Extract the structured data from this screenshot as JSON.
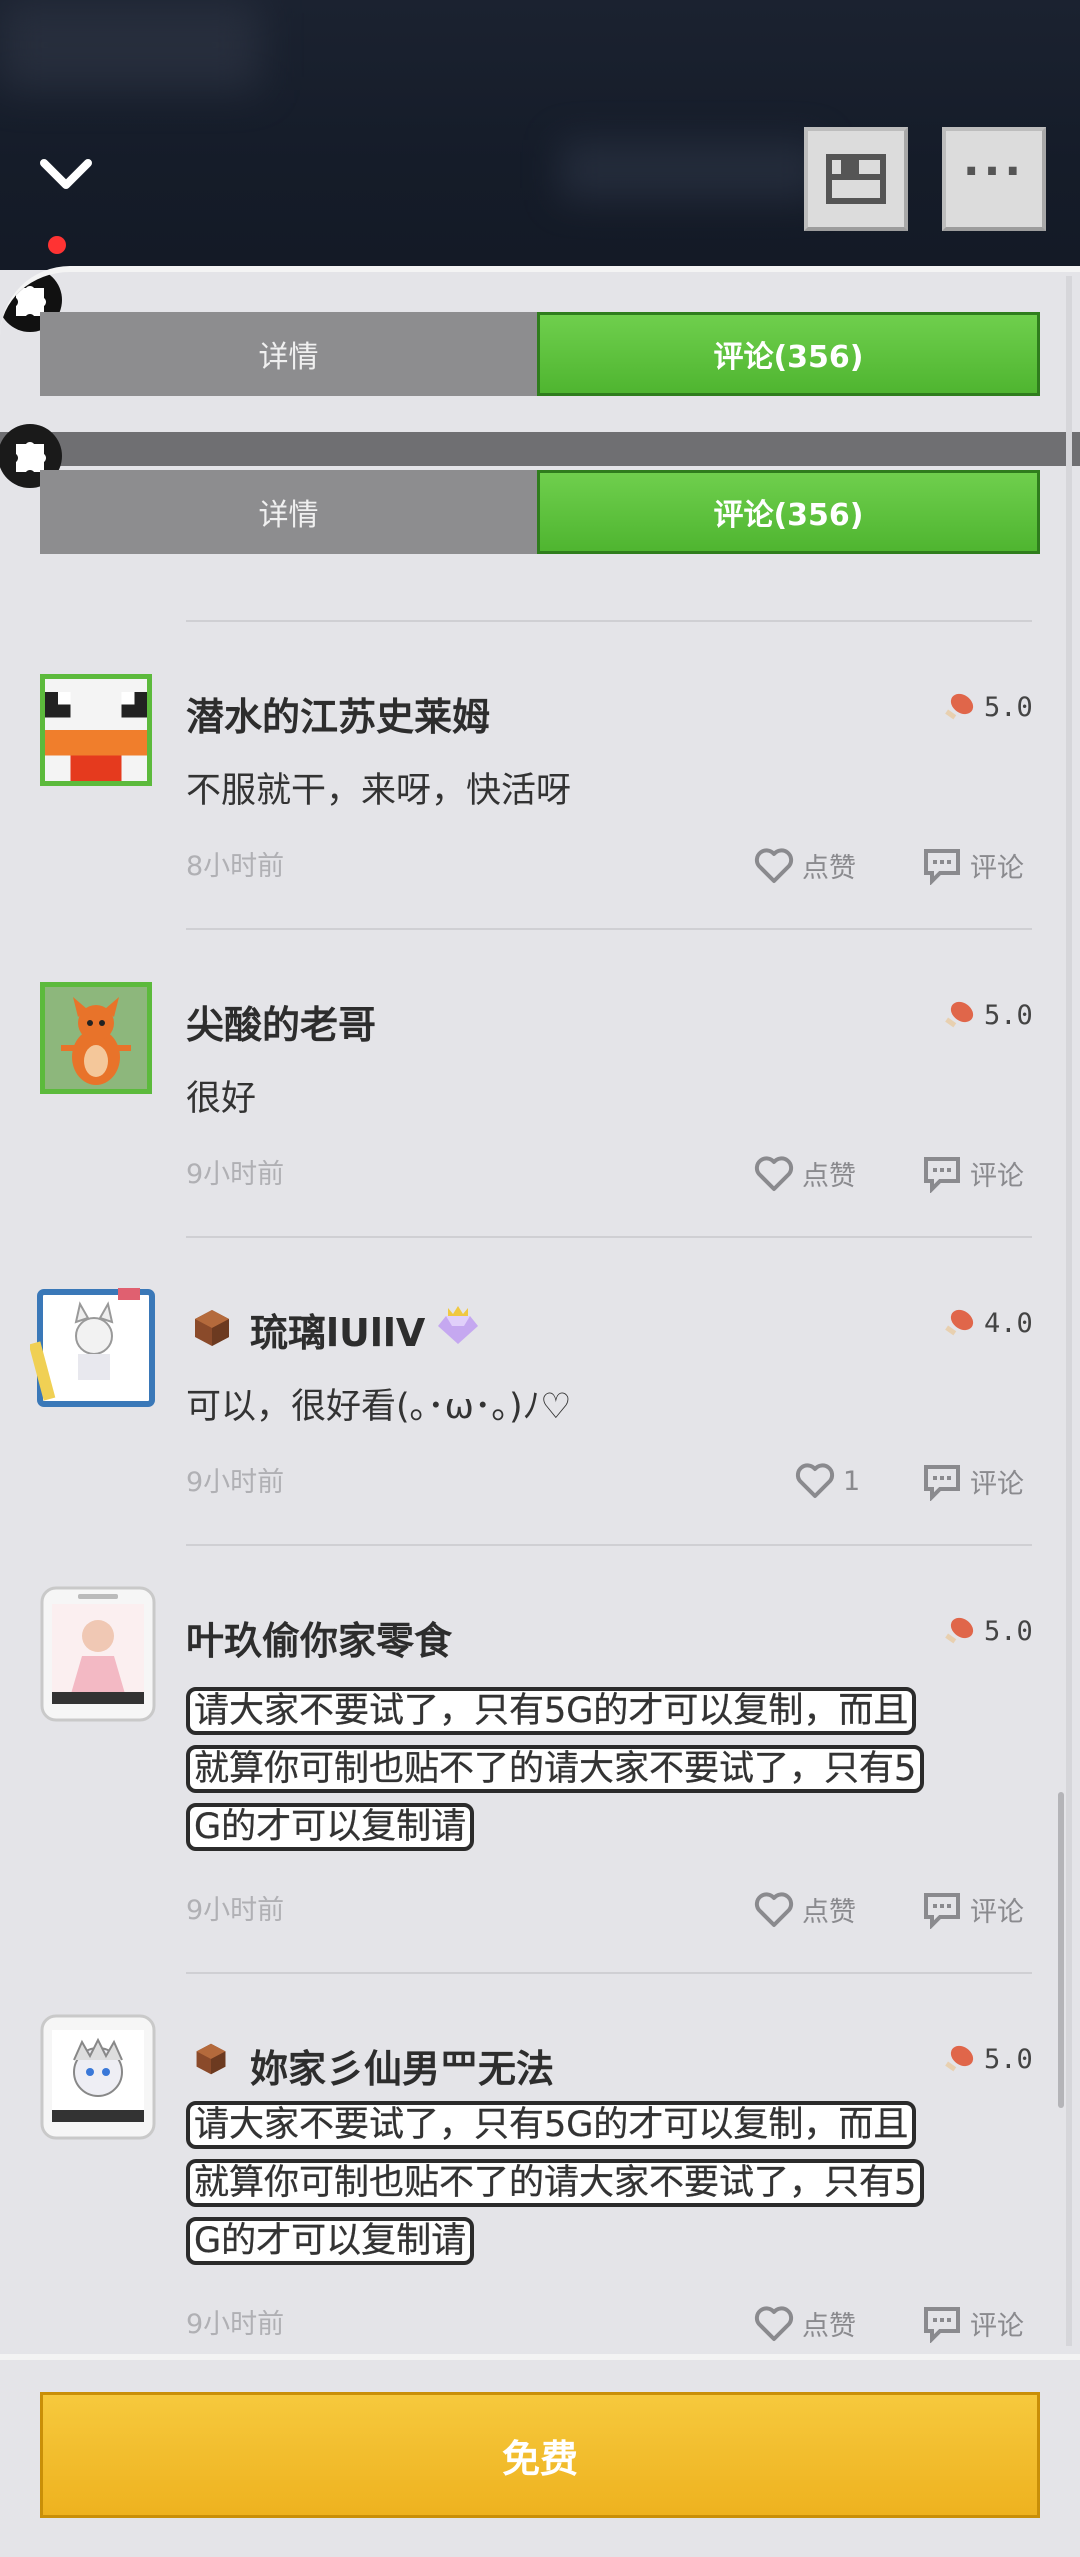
{
  "header": {
    "collapse_icon": "chevron-down-icon",
    "folder_icon": "folder-icon",
    "more_icon": "more-icon"
  },
  "tabs": {
    "details": "详情",
    "comments": "评论(356)"
  },
  "comments": [
    {
      "name": "潜水的江苏史莱姆",
      "rating": "5.0",
      "text": "不服就干，来呀，快活呀",
      "time": "8小时前",
      "like": "点赞",
      "reply": "评论"
    },
    {
      "name": "尖酸的老哥",
      "rating": "5.0",
      "text": "很好",
      "time": "9小时前",
      "like": "点赞",
      "reply": "评论"
    },
    {
      "name": "琉璃lUllV",
      "rating": "4.0",
      "text": "可以，很好看(｡･ω･｡)ﾉ♡",
      "time": "9小时前",
      "like": "1",
      "reply": "评论"
    },
    {
      "name": "叶玖偷你家零食",
      "rating": "5.0",
      "text_lines": [
        "请大家不要试了，只有5G的才可以复制，而且",
        "就算你可制也贴不了的请大家不要试了，只有5",
        "G的才可以复制请"
      ],
      "time": "9小时前",
      "like": "点赞",
      "reply": "评论"
    },
    {
      "name": "妳家彡仙男罒无法",
      "rating": "5.0",
      "text_lines": [
        "请大家不要试了，只有5G的才可以复制，而且",
        "就算你可制也贴不了的请大家不要试了，只有5",
        "G的才可以复制请"
      ],
      "time": "9小时前",
      "like": "点赞",
      "reply": "评论"
    }
  ],
  "footer": {
    "free_button": "免费"
  },
  "colors": {
    "tab_active": "#5ac03a",
    "tab_inactive": "#8d8d8f",
    "free_button": "#f2bd2c",
    "header_bg": "#171e2b"
  }
}
